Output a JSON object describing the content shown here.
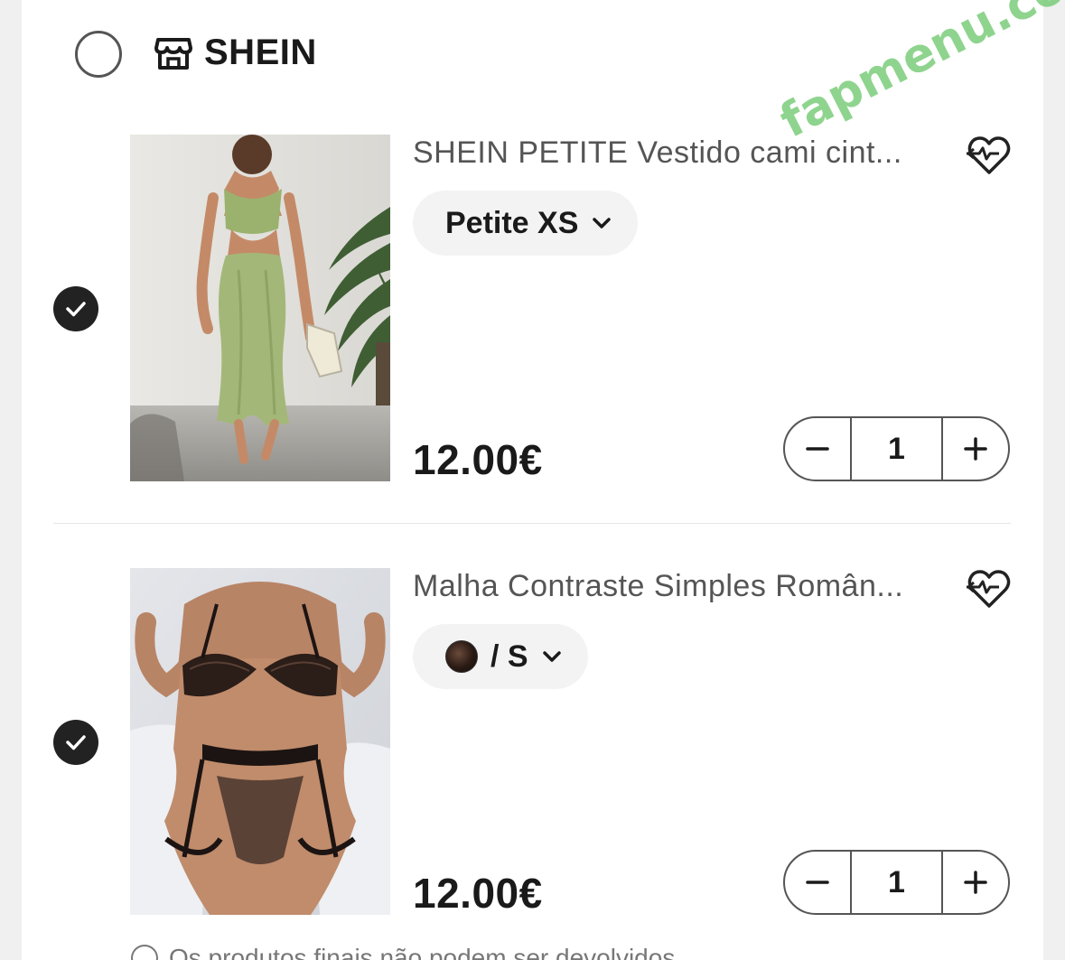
{
  "store": {
    "name": "SHEIN",
    "icon": "store-icon"
  },
  "items": [
    {
      "title": "SHEIN PETITE Vestido cami cint...",
      "variant_label": "Petite XS",
      "price": "12.00€",
      "quantity": "1",
      "selected": true,
      "image": "green-midi-dress-photo"
    },
    {
      "title": "Malha Contraste Simples Român...",
      "variant_label": "/ S",
      "price": "12.00€",
      "quantity": "1",
      "selected": true,
      "image": "black-lace-lingerie-photo"
    }
  ],
  "footnote": {
    "text": "Os produtos finais não podem ser devolvidos"
  },
  "watermark": "fapmenu.com",
  "colors": {
    "check_bg": "#222222",
    "pill_bg": "#f3f3f3",
    "page_bg": "#f0f0f0",
    "watermark": "#6ec86e"
  }
}
